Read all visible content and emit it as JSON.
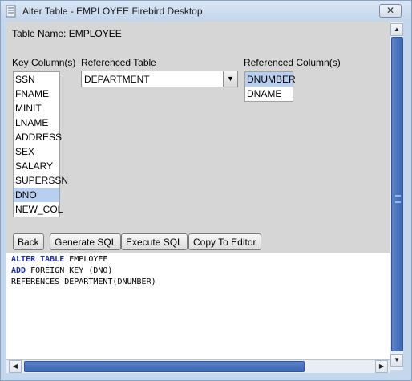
{
  "window": {
    "title": "Alter Table - EMPLOYEE Firebird Desktop",
    "close_glyph": "✕"
  },
  "form": {
    "table_name_label": "Table Name: EMPLOYEE",
    "key_columns_label": "Key Column(s)",
    "referenced_table_label": "Referenced Table",
    "referenced_columns_label": "Referenced Column(s)",
    "key_columns": [
      "SSN",
      "FNAME",
      "MINIT",
      "LNAME",
      "ADDRESS",
      "SEX",
      "SALARY",
      "SUPERSSN",
      "DNO",
      "NEW_COL"
    ],
    "key_columns_selected": "DNO",
    "referenced_table_value": "DEPARTMENT",
    "referenced_columns": [
      "DNUMBER",
      "DNAME"
    ],
    "referenced_columns_selected": "DNUMBER"
  },
  "buttons": {
    "back": "Back",
    "generate_sql": "Generate SQL",
    "execute_sql": "Execute SQL",
    "copy_to_editor": "Copy To Editor"
  },
  "sql": {
    "line1_kw": "ALTER TABLE",
    "line1_rest": " EMPLOYEE",
    "line2_kw": "ADD",
    "line2_rest": " FOREIGN KEY (DNO)",
    "line3": "REFERENCES DEPARTMENT(DNUMBER)"
  },
  "icons": {
    "app": "firebird-app-icon",
    "combo_arrow": "▼",
    "scroll_up": "▲",
    "scroll_down": "▼",
    "scroll_left": "◀",
    "scroll_right": "▶"
  },
  "colors": {
    "selection": "#b8cff0",
    "keyword": "#1f2fa6",
    "scroll_thumb": "#4a73bd"
  }
}
